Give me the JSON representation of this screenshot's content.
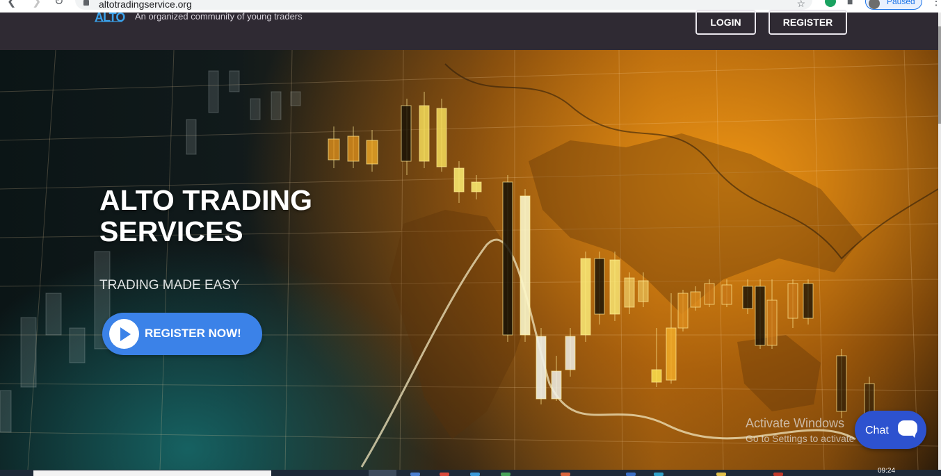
{
  "browser": {
    "url": "altotradingservice.org",
    "profile_status": "Paused"
  },
  "header": {
    "logo_text": "ALTO",
    "tagline": "An organized community of young traders",
    "login_label": "LOGIN",
    "register_label": "REGISTER"
  },
  "hero": {
    "title": "ALTO TRADING SERVICES",
    "subtitle": "TRADING MADE EASY",
    "cta_label": "REGISTER NOW!"
  },
  "watermark": {
    "line1": "Activate Windows",
    "line2": "Go to Settings to activate Windows."
  },
  "chat": {
    "label": "Chat"
  },
  "taskbar": {
    "clock": "09:24"
  },
  "colors": {
    "header_bg": "#2f2a33",
    "accent_blue": "#3b82e8",
    "chat_blue": "#2d52cf",
    "hero_orange": "#f0961a",
    "hero_teal": "#176e6e"
  },
  "icons": [
    "back-arrow-icon",
    "forward-arrow-icon",
    "reload-icon",
    "lock-icon",
    "star-icon",
    "extension-icon",
    "puzzle-icon",
    "kebab-menu-icon",
    "play-icon",
    "chat-bubble-icon"
  ]
}
